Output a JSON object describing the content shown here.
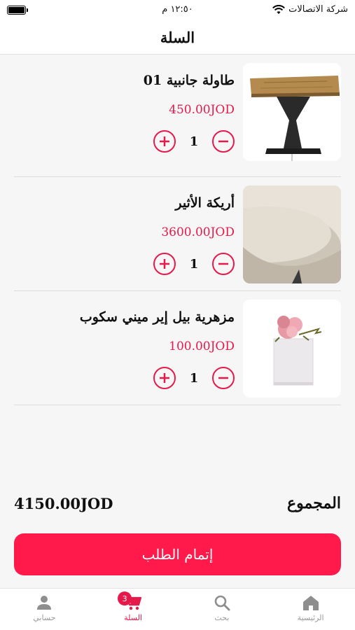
{
  "status_bar": {
    "carrier": "شركة الاتصالات",
    "time": "١٢:٥٠ م"
  },
  "header": {
    "title": "السلة"
  },
  "cart": {
    "items": [
      {
        "name": "طاولة جانبية 01",
        "price": "450.00JOD",
        "quantity": "1",
        "image": "side-table-image"
      },
      {
        "name": "أريكة الأثير",
        "price": "3600.00JOD",
        "quantity": "1",
        "image": "beige-sofa-image"
      },
      {
        "name": "مزهرية بيل إير ميني سكوب",
        "price": "100.00JOD",
        "quantity": "1",
        "image": "flower-vase-image"
      }
    ]
  },
  "summary": {
    "label": "المجموع",
    "total": "4150.00JOD"
  },
  "checkout": {
    "label": "إتمام الطلب"
  },
  "tabs": [
    {
      "label": "حسابي",
      "icon": "person-icon"
    },
    {
      "label": "السلة",
      "icon": "cart-icon",
      "badge": "3",
      "active": true
    },
    {
      "label": "بحث",
      "icon": "search-icon"
    },
    {
      "label": "الرئيسية",
      "icon": "home-icon"
    }
  ],
  "colors": {
    "accent": "#e6194b",
    "checkout_button": "#ff1a4b",
    "background": "#f6f6f6"
  }
}
